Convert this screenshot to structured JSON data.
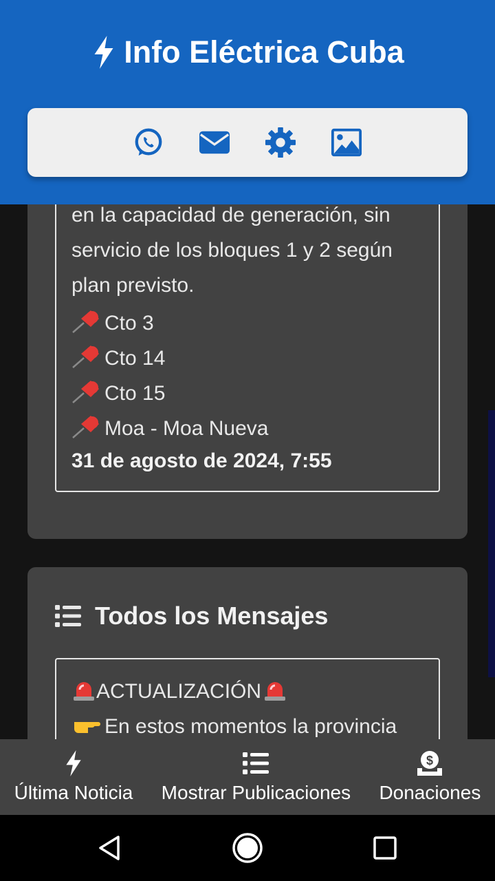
{
  "header": {
    "title": "Info Eléctrica Cuba",
    "icons": [
      "whatsapp-icon",
      "envelope-icon",
      "gear-icon",
      "image-icon"
    ]
  },
  "current_post": {
    "lines": [
      "en la capacidad de generación, sin",
      "servicio de los bloques 1 y 2 según",
      "plan previsto."
    ],
    "circuits": [
      "Cto 3",
      "Cto 14",
      "Cto 15",
      "Moa - Moa Nueva"
    ],
    "date": "31 de agosto de 2024, 7:55"
  },
  "all_messages": {
    "title": "Todos los Mensajes",
    "first_message": {
      "heading": "ACTUALIZACIÓN",
      "line": "En estos momentos la provincia"
    }
  },
  "bottom_nav": {
    "items": [
      {
        "label": "Última Noticia",
        "icon": "bolt-icon"
      },
      {
        "label": "Mostrar Publicaciones",
        "icon": "list-icon"
      },
      {
        "label": "Donaciones",
        "icon": "donate-icon"
      }
    ]
  },
  "colors": {
    "header_bg": "#1565c0",
    "card_bg": "#424242",
    "page_bg": "#141414",
    "icon_blue": "#1565c0"
  }
}
